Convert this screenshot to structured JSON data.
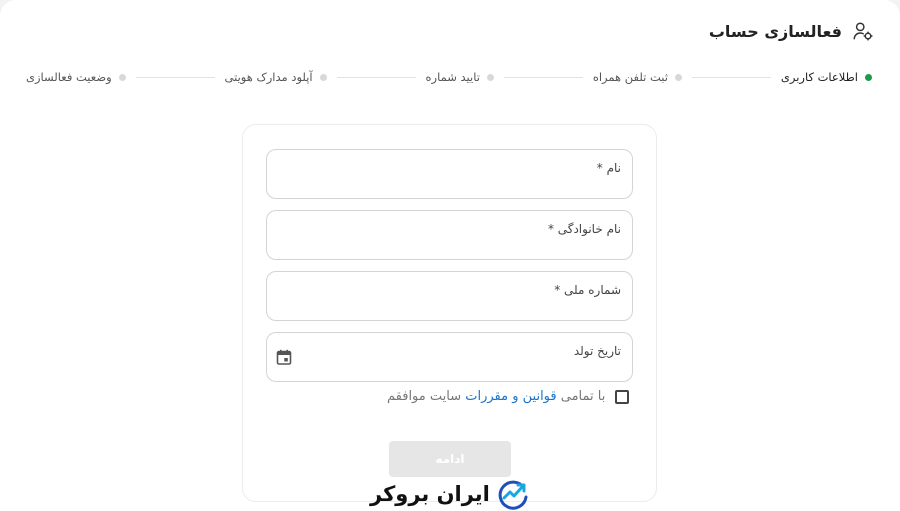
{
  "header": {
    "title": "فعالسازی حساب",
    "icon": "user-settings-icon"
  },
  "stepper": {
    "active_color": "#1a9a4a",
    "steps": [
      {
        "label": "اطلاعات کاربری",
        "active": true
      },
      {
        "label": "ثبت تلفن همراه",
        "active": false
      },
      {
        "label": "تایید شماره",
        "active": false
      },
      {
        "label": "آپلود مدارک هویتی",
        "active": false
      },
      {
        "label": "وضعیت فعالسازی",
        "active": false
      }
    ]
  },
  "form": {
    "first_name_label": "نام *",
    "last_name_label": "نام خانوادگی *",
    "national_id_label": "شماره ملی *",
    "birth_date_label": "تاریخ تولد",
    "birth_date_icon": "calendar-icon",
    "terms": {
      "prefix": "با تمامی ",
      "link": "قوانین و مقررات",
      "suffix": " سایت موافقم",
      "checked": false,
      "link_color": "#1a73c9"
    },
    "continue_label": "ادامه"
  },
  "brand": {
    "name": "ایران بروکر",
    "colors": [
      "#1f4fb8",
      "#18a8e0"
    ]
  }
}
